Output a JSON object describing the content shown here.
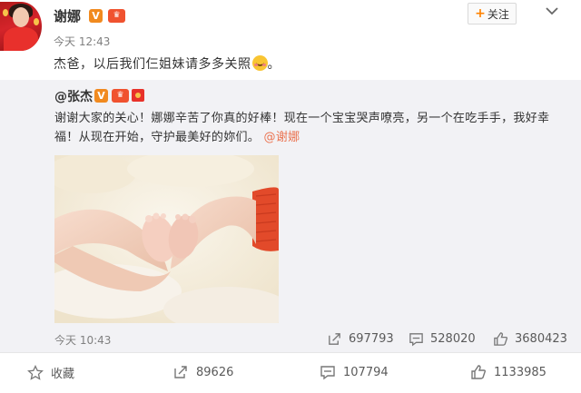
{
  "author": {
    "name": "谢娜",
    "verified_icon": "v-badge-icon",
    "level_icon": "member-badge-icon",
    "time": "今天 12:43"
  },
  "header": {
    "follow_label": "关注",
    "menu_icon": "chevron-down-icon"
  },
  "post": {
    "text": "杰爸，以后我们仨姐妹请多多关照",
    "emoji": "smiling-emoji",
    "text_end": "。"
  },
  "repost": {
    "author": "@张杰",
    "text": "谢谢大家的关心！娜娜辛苦了你真的好棒！现在一个宝宝哭声嘹亮，另一个在吃手手，我好幸福！从现在开始，守护最美好的妳们。",
    "mention": "@谢娜",
    "time": "今天 10:43",
    "stats": {
      "reposts": "697793",
      "comments": "528020",
      "likes": "3680423"
    }
  },
  "actions": {
    "favorite_label": "收藏",
    "repost_count": "89626",
    "comment_count": "107794",
    "like_count": "1133985"
  },
  "colors": {
    "accent_orange": "#ff8200",
    "mention": "#eb7350",
    "repost_bg": "#f2f2f5"
  }
}
